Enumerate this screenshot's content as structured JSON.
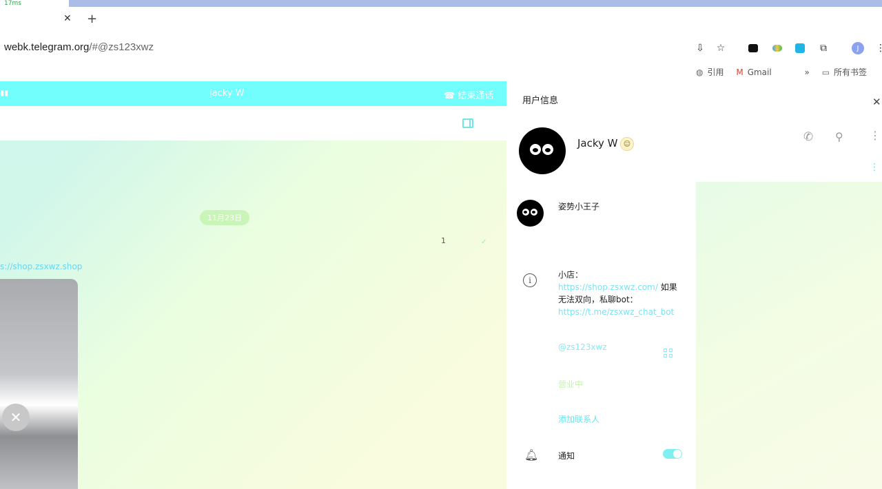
{
  "browser": {
    "tab_fragment": "17ms",
    "url_host": "webk.telegram.org",
    "url_rest": "/#@zs123xwz",
    "bookmarks": [
      {
        "icon": "globe-icon",
        "label": "引用"
      },
      {
        "icon": "gmail-icon",
        "label": "Gmail"
      },
      {
        "icon": "folder-icon",
        "label": "所有书签"
      }
    ],
    "profile_initial": "J"
  },
  "call": {
    "name": "jacky W",
    "end_label": "结束通话"
  },
  "chat": {
    "date_label": "11月23日",
    "message_text": "1",
    "link_fragment": "s://shop.zsxwz.shop"
  },
  "panel": {
    "title": "用户信息",
    "name": "Jacky W",
    "secondary_name": "姿势小王子",
    "bio_prefix": "小店：",
    "bio_link1": "https://shop.zsxwz.com/",
    "bio_mid": " 如果无法双向，私聊bot：",
    "bio_link2": "https://t.me/zsxwz_chat_bot",
    "username": "@zs123xwz",
    "status": "营业中",
    "add_contact": "添加联系人",
    "notifications_label": "通知",
    "notifications_on": true
  },
  "colors": {
    "accent": "#72fefc",
    "link": "#7ee2f2"
  }
}
